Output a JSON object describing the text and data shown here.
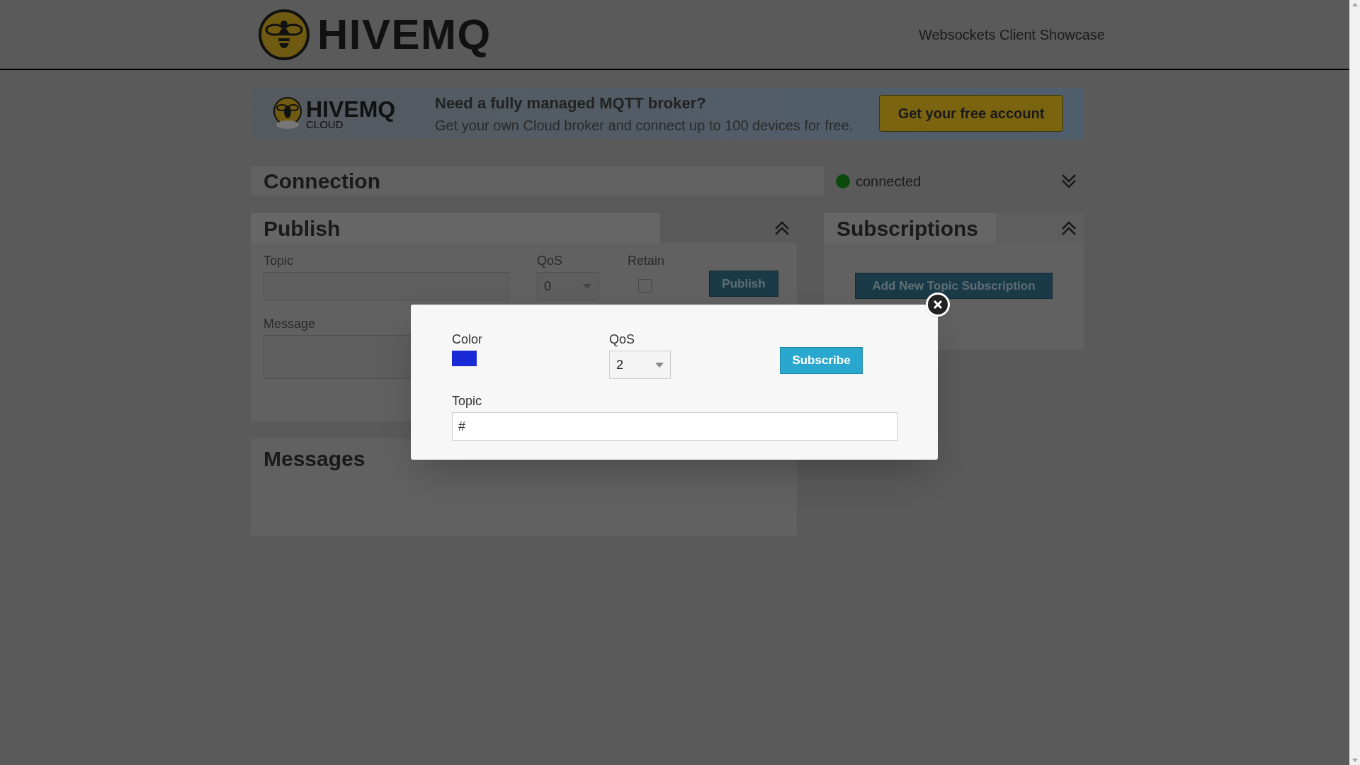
{
  "header": {
    "logo_text": "HIVEMQ",
    "nav_title": "Websockets Client Showcase"
  },
  "banner": {
    "logo_text": "HIVEMQ",
    "logo_subtext": "CLOUD",
    "headline": "Need a fully managed MQTT broker?",
    "text": "Get your own Cloud broker and connect up to 100 devices for free.",
    "button": "Get your free account"
  },
  "connection": {
    "title": "Connection",
    "status": "connected",
    "connected": true,
    "expanded": false
  },
  "publish": {
    "title": "Publish",
    "expanded": true,
    "topic_label": "Topic",
    "qos_label": "QoS",
    "qos_value": "0",
    "retain_label": "Retain",
    "retain_checked": false,
    "button": "Publish",
    "message_label": "Message"
  },
  "messages": {
    "title": "Messages"
  },
  "subscriptions": {
    "title": "Subscriptions",
    "expanded": true,
    "button": "Add New Topic Subscription"
  },
  "subscribe_dialog": {
    "color_label": "Color",
    "color": "#1a2ad6",
    "qos_label": "QoS",
    "qos_value": "2",
    "button": "Subscribe",
    "topic_label": "Topic",
    "topic_value": "#"
  }
}
